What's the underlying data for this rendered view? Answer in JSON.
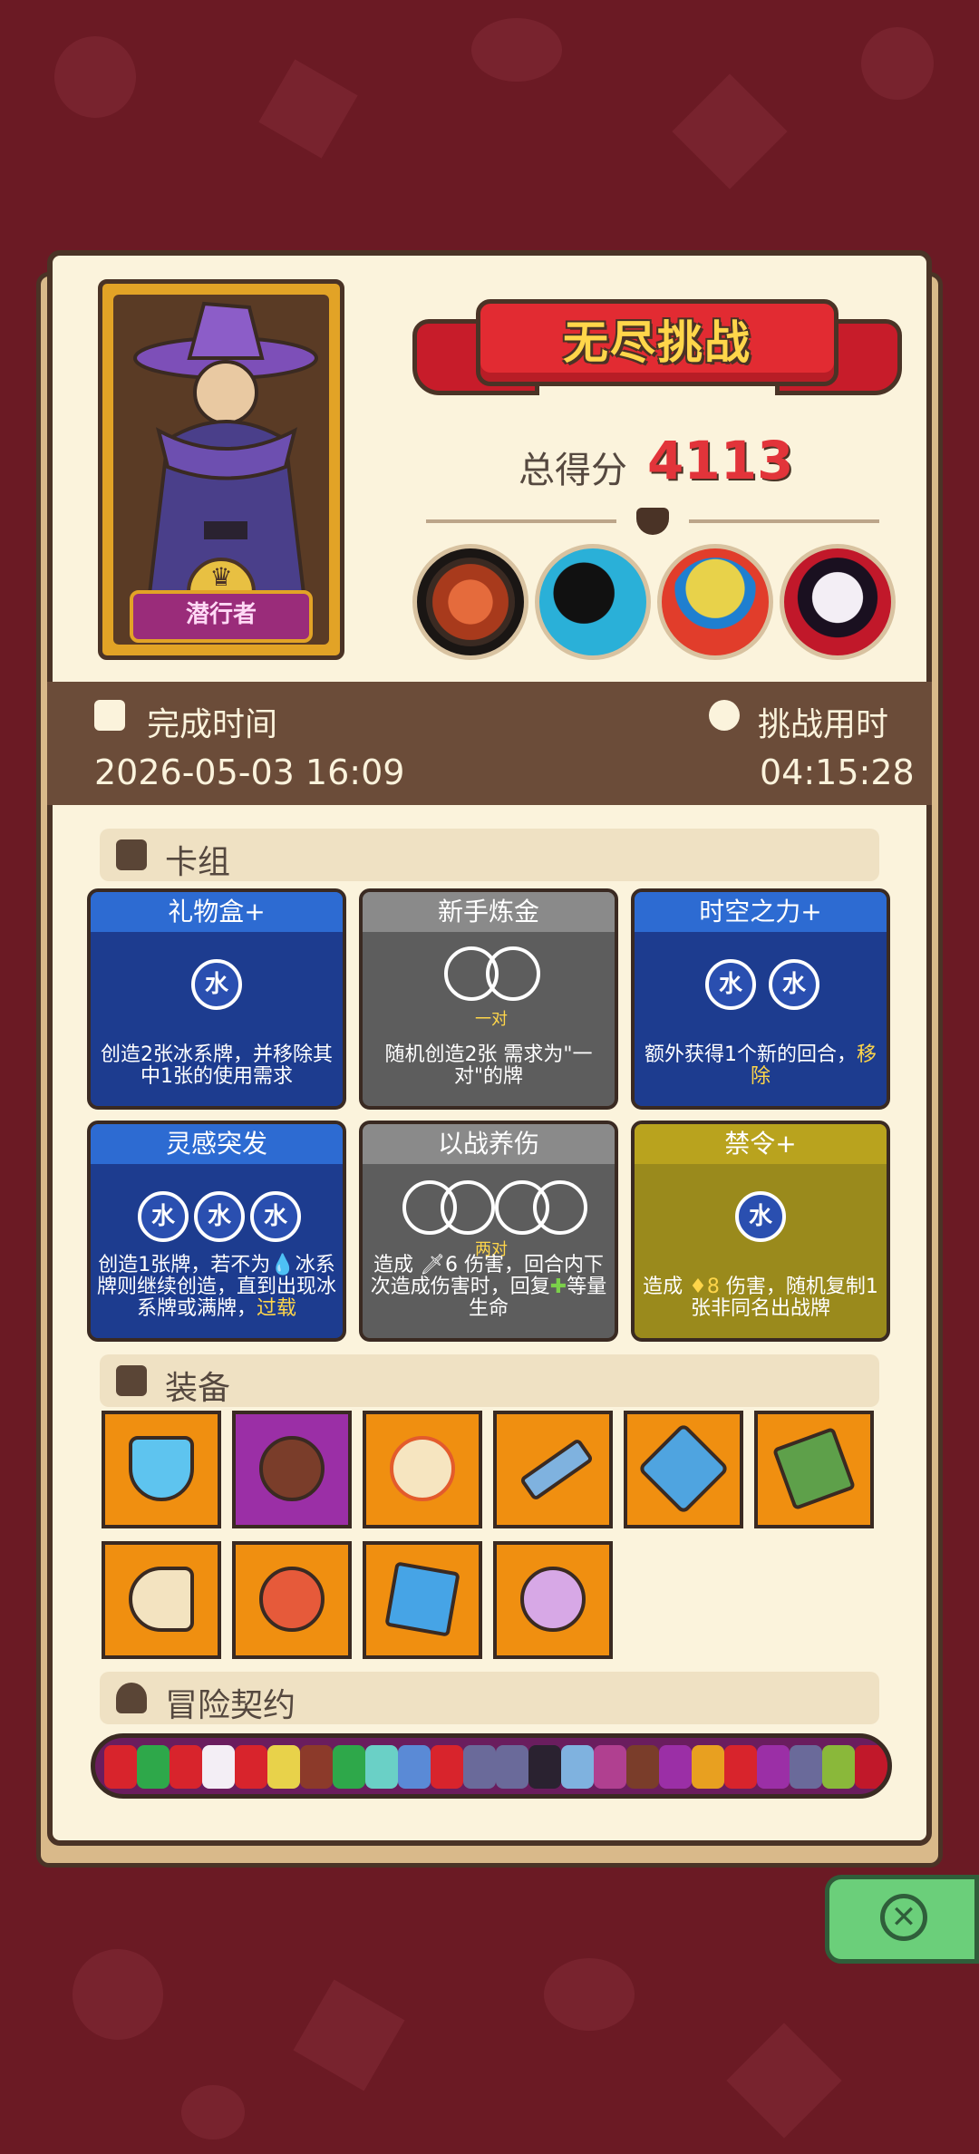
{
  "title": "无尽挑战",
  "character": {
    "name": "潜行者"
  },
  "score": {
    "label": "总得分",
    "value": "4113"
  },
  "completion": {
    "time_label": "完成时间",
    "time_value": "2026-05-03 16:09",
    "duration_label": "挑战用时",
    "duration_value": "04:15:28"
  },
  "deck": {
    "title": "卡组",
    "cards": [
      {
        "name": "礼物盒+",
        "color": "blue",
        "orb_text": "水",
        "desc": "创造2张冰系牌，并移除其中1张的使用需求"
      },
      {
        "name": "新手炼金",
        "color": "gray",
        "pair_label": "一对",
        "desc": "随机创造2张 需求为\"一对\"的牌"
      },
      {
        "name": "时空之力+",
        "color": "blue",
        "orb_text": "水",
        "desc_a": "额外获得1个新的回合，",
        "desc_b": "移除"
      },
      {
        "name": "灵感突发",
        "color": "blue",
        "orb_text": "水",
        "desc_a": "创造1张牌，若不为",
        "desc_b": "冰系牌则继续创造，直到出现冰系牌或满牌，",
        "desc_c": "过载"
      },
      {
        "name": "以战养伤",
        "color": "gray",
        "pair_label": "两对",
        "desc_a": "造成",
        "desc_b": "6 伤害，回合内下次造成伤害时，回复",
        "desc_c": "等量生命"
      },
      {
        "name": "禁令+",
        "color": "gold",
        "orb_text": "水",
        "desc_a": "造成",
        "desc_b": "8",
        "desc_c": "伤害，随机复制1张非同名出战牌"
      }
    ]
  },
  "equipment": {
    "title": "装备"
  },
  "contract": {
    "title": "冒险契约"
  },
  "colors": {
    "accent_red": "#e2343a",
    "panel": "#fbf3dc",
    "band": "#6b4c39"
  }
}
